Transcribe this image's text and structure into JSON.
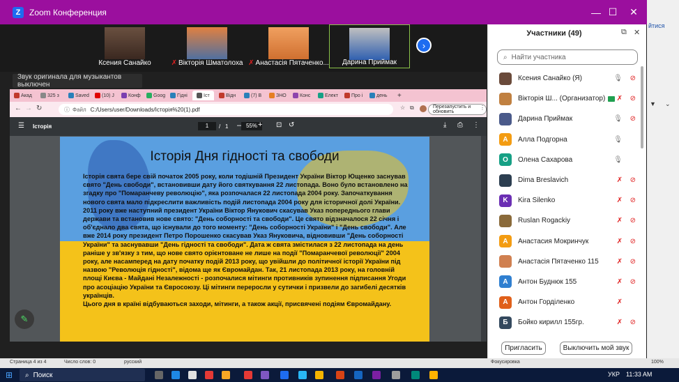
{
  "window": {
    "title": "Zoom Конференция"
  },
  "gallery": {
    "participants": [
      {
        "name": "Ксения Санайко",
        "muted": false
      },
      {
        "name": "Вікторія Шматолоха",
        "muted": true
      },
      {
        "name": "Анастасія Пятаченко...",
        "muted": true
      },
      {
        "name": "Дарина Приймак",
        "muted": false
      }
    ]
  },
  "tooltip": "Звук оригинала для музыкантов выключен",
  "browser": {
    "tabs": [
      "Акад",
      "325 з",
      "Saved",
      "(10) J",
      "Конф",
      "Goog",
      "Гідні",
      "Іст",
      "Відн",
      "(7) В",
      "ЗНО",
      "Конс",
      "Елект",
      "Про і",
      "день"
    ],
    "url_prefix": "Файл",
    "url": "C:/Users/user/Downloads/Історія%20(1).pdf",
    "relaunch": "Перезапустить и обновить"
  },
  "pdf": {
    "filename": "Історія",
    "page_current": "1",
    "page_sep": "/",
    "page_total": "1",
    "zoom": "55%"
  },
  "slide": {
    "title": "Історія Дня гідності та свободи",
    "body": "Історія свята бере свій початок 2005 року, коли тодішній Президент України Віктор Ющенко заснував свято \"День свободи\", встановивши дату його святкування 22 листопада. Воно було встановлено на згадку про \"Помаранчеву революцію\", яка розпочалася 22 листопада 2004 року. Започаткування нового свята мало підкреслити важливість подій листопада 2004 року для історичної долі України. 2011 року вже наступний президент України Віктор Янукович скасував Указ попереднього глави держави та встановив нове свято: \"День соборності та свободи\". Це свято відзначалося 22 січня і об'єднало два свята, що існували до того моменту: \"День соборності України\" і \"День свободи\". Але вже 2014 року президент Петро Порошенко скасував Указ Януковича, відновивши \"День соборності України\" та заснувавши \"День гідності та свободи\". Дата ж свята змістилася з 22 листопада на день раніше у зв'язку з тим, що нове свято орієнтоване не лише на події \"Помаранчевої революції\" 2004 року, але насамперед на дату початку подій 2013 року, що увійшли до політичної історії України під назвою \"Революція гідності\", відома ще як Євромайдан. Так, 21 листопада 2013 року, на головній площі Києва - Майдані Незалежності - розпочалися мітинги противників зупинення підписання Угоди про асоціацію України та Євросоюзу. Ці мітинги переросли у сутички і призвели до загибелі десятків українців.",
    "body2": "Цього дня в країні відбуваються заходи, мітинги, а також акції, присвячені подіям Євромайдану."
  },
  "panel": {
    "title": "Участники (49)",
    "search_placeholder": "Найти участника",
    "list": [
      {
        "name": "Ксения Санайко (Я)",
        "avatar": "img",
        "color": "#6a4a3a",
        "letter": "",
        "mic": "on",
        "cam": "off"
      },
      {
        "name": "Вікторія Ш... (Организатор)",
        "avatar": "img",
        "color": "#c08040",
        "letter": "",
        "mic": "off",
        "cam": "off",
        "host": true
      },
      {
        "name": "Дарина Приймак",
        "avatar": "img",
        "color": "#4a5a8a",
        "letter": "",
        "mic": "on",
        "cam": "off"
      },
      {
        "name": "Алла Подгорна",
        "avatar": "letter",
        "color": "#f39c12",
        "letter": "А",
        "mic": "on",
        "cam": "none"
      },
      {
        "name": "Олена Сахарова",
        "avatar": "letter",
        "color": "#16a085",
        "letter": "О",
        "mic": "on",
        "cam": "none"
      },
      {
        "name": "Dima Breslavich",
        "avatar": "img",
        "color": "#2c3e50",
        "letter": "",
        "mic": "off",
        "cam": "off"
      },
      {
        "name": "Kira Silenko",
        "avatar": "letter",
        "color": "#6b2fb3",
        "letter": "K",
        "mic": "off",
        "cam": "off"
      },
      {
        "name": "Ruslan Rogackiy",
        "avatar": "img",
        "color": "#8a6a3a",
        "letter": "",
        "mic": "off",
        "cam": "off"
      },
      {
        "name": "Анастасия Мокринчук",
        "avatar": "letter",
        "color": "#f39c12",
        "letter": "А",
        "mic": "off",
        "cam": "off"
      },
      {
        "name": "Анастасія Пятаченко 115",
        "avatar": "img",
        "color": "#d08050",
        "letter": "",
        "mic": "off",
        "cam": "off"
      },
      {
        "name": "Антон Буднюк 155",
        "avatar": "letter",
        "color": "#2f7fd0",
        "letter": "А",
        "mic": "off",
        "cam": "off"
      },
      {
        "name": "Антон Горділенко",
        "avatar": "letter",
        "color": "#e0601a",
        "letter": "А",
        "mic": "off",
        "cam": "none"
      },
      {
        "name": "Бойко кирилл 155гр.",
        "avatar": "letter",
        "color": "#34495e",
        "letter": "Б",
        "mic": "off",
        "cam": "off"
      }
    ],
    "invite": "Пригласить",
    "mute_me": "Выключить мой звук"
  },
  "taskbar": {
    "search": "Поиск",
    "lang": "УКР",
    "time": "11:33 AM"
  },
  "statusbar": {
    "left": "Страница 4 из 4",
    "words": "Число слов: 0",
    "lang": "русский",
    "focus": "Фокусировка",
    "zoom": "100%"
  }
}
